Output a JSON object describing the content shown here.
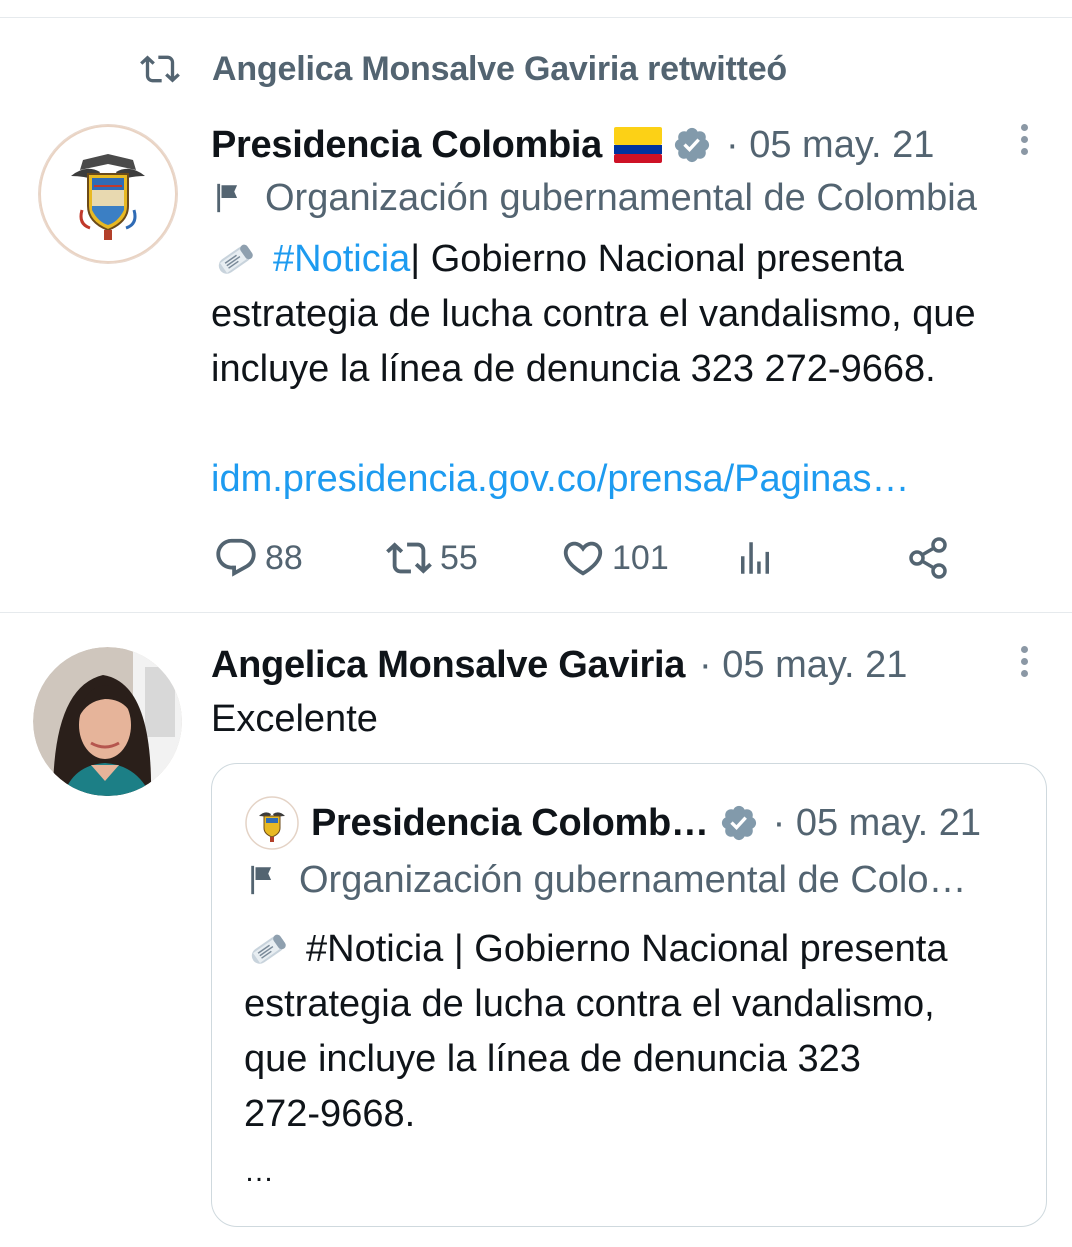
{
  "retweet": {
    "text": "Angelica Monsalve Gaviria retwitteó"
  },
  "tweet1": {
    "author": "Presidencia Colombia",
    "flag_emoji": "🇨🇴",
    "date": "· 05 may. 21",
    "label": "Organización gubernamental de Colombia",
    "hashtag": "#Noticia",
    "body_line1_rest": " | Gobierno Nacional presenta",
    "body_line2": "estrategia de lucha contra el vandalismo, que",
    "body_line3": "incluye la línea de denuncia 323 272-9668.",
    "link": "idm.presidencia.gov.co/prensa/Paginas…",
    "actions": {
      "replies": "88",
      "retweets": "55",
      "likes": "101"
    }
  },
  "tweet2": {
    "author": "Angelica Monsalve Gaviria",
    "date": "· 05 may. 21",
    "text": "Excelente"
  },
  "quote": {
    "author": "Presidencia Colomb…",
    "date": "· 05 may. 21",
    "label": "Organización gubernamental de Colo…",
    "line1": "#Noticia | Gobierno Nacional presenta",
    "line2": "estrategia de lucha contra el vandalismo,",
    "line3": "que incluye la línea de denuncia 323",
    "line4": "272-9668.",
    "ellipsis": "…"
  },
  "colors": {
    "accent": "#1d9bf0",
    "muted": "#536471",
    "verified": "#829aab"
  },
  "icons": [
    "retweet-icon",
    "coat-of-arms-avatar",
    "flag-colombia-icon",
    "verified-badge-icon",
    "more-icon",
    "flag-icon",
    "newspaper-emoji-icon",
    "reply-icon",
    "like-icon",
    "views-icon",
    "share-icon",
    "person-avatar"
  ]
}
